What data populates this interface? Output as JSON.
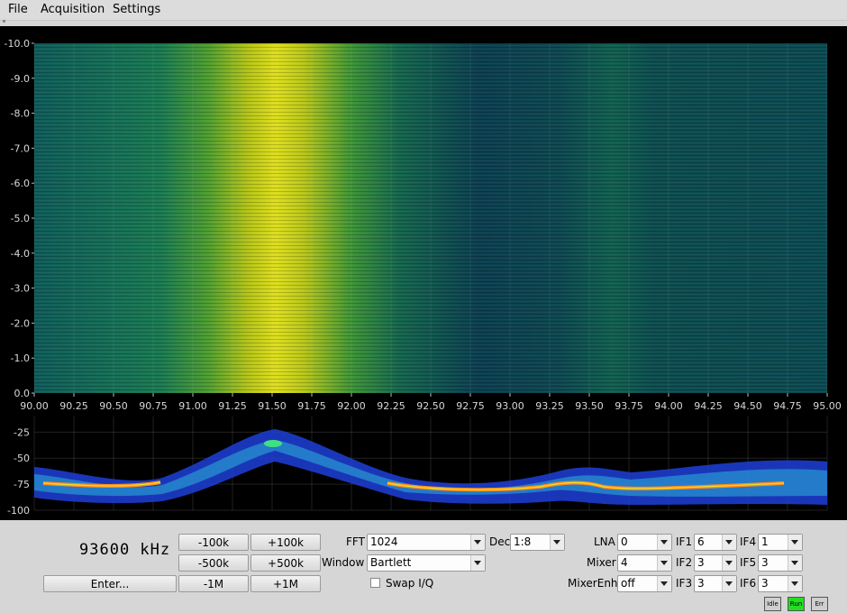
{
  "menu": {
    "file": "File",
    "acquisition": "Acquisition",
    "settings": "Settings"
  },
  "waterfall": {
    "y_ticks": [
      "-10.0",
      "-9.0",
      "-8.0",
      "-7.0",
      "-6.0",
      "-5.0",
      "-4.0",
      "-3.0",
      "-2.0",
      "-1.0",
      "0.0"
    ],
    "x_ticks": [
      "90.00",
      "90.25",
      "90.50",
      "90.75",
      "91.00",
      "91.25",
      "91.50",
      "91.75",
      "92.00",
      "92.25",
      "92.50",
      "92.75",
      "93.00",
      "93.25",
      "93.50",
      "93.75",
      "94.00",
      "94.25",
      "94.50",
      "94.75",
      "95.00"
    ]
  },
  "spectrum": {
    "y_ticks": [
      "-25",
      "-50",
      "-75",
      "-100"
    ],
    "ylim": [
      -100,
      -10
    ]
  },
  "controls": {
    "frequency": "93600 kHz",
    "buttons": {
      "minus_100k": "-100k",
      "plus_100k": "+100k",
      "minus_500k": "-500k",
      "plus_500k": "+500k",
      "minus_1m": "-1M",
      "plus_1m": "+1M",
      "enter": "Enter..."
    },
    "fft_label": "FFT",
    "fft_value": "1024",
    "dec_label": "Dec",
    "dec_value": "1:8",
    "window_label": "Window",
    "window_value": "Bartlett",
    "swap_label": "Swap I/Q",
    "lna_label": "LNA",
    "lna_value": "0",
    "mixer_label": "Mixer",
    "mixer_value": "4",
    "mixerenh_label": "MixerEnh",
    "mixerenh_value": "off",
    "if1_label": "IF1",
    "if1_value": "6",
    "if2_label": "IF2",
    "if2_value": "3",
    "if3_label": "IF3",
    "if3_value": "3",
    "if4_label": "IF4",
    "if4_value": "1",
    "if5_label": "IF5",
    "if5_value": "3",
    "if6_label": "IF6",
    "if6_value": "3"
  },
  "status": {
    "idle": "Idle",
    "run": "Run",
    "err": "Err"
  },
  "colors": {
    "run_led": "#22dd22",
    "plot_bg": "#000000"
  }
}
